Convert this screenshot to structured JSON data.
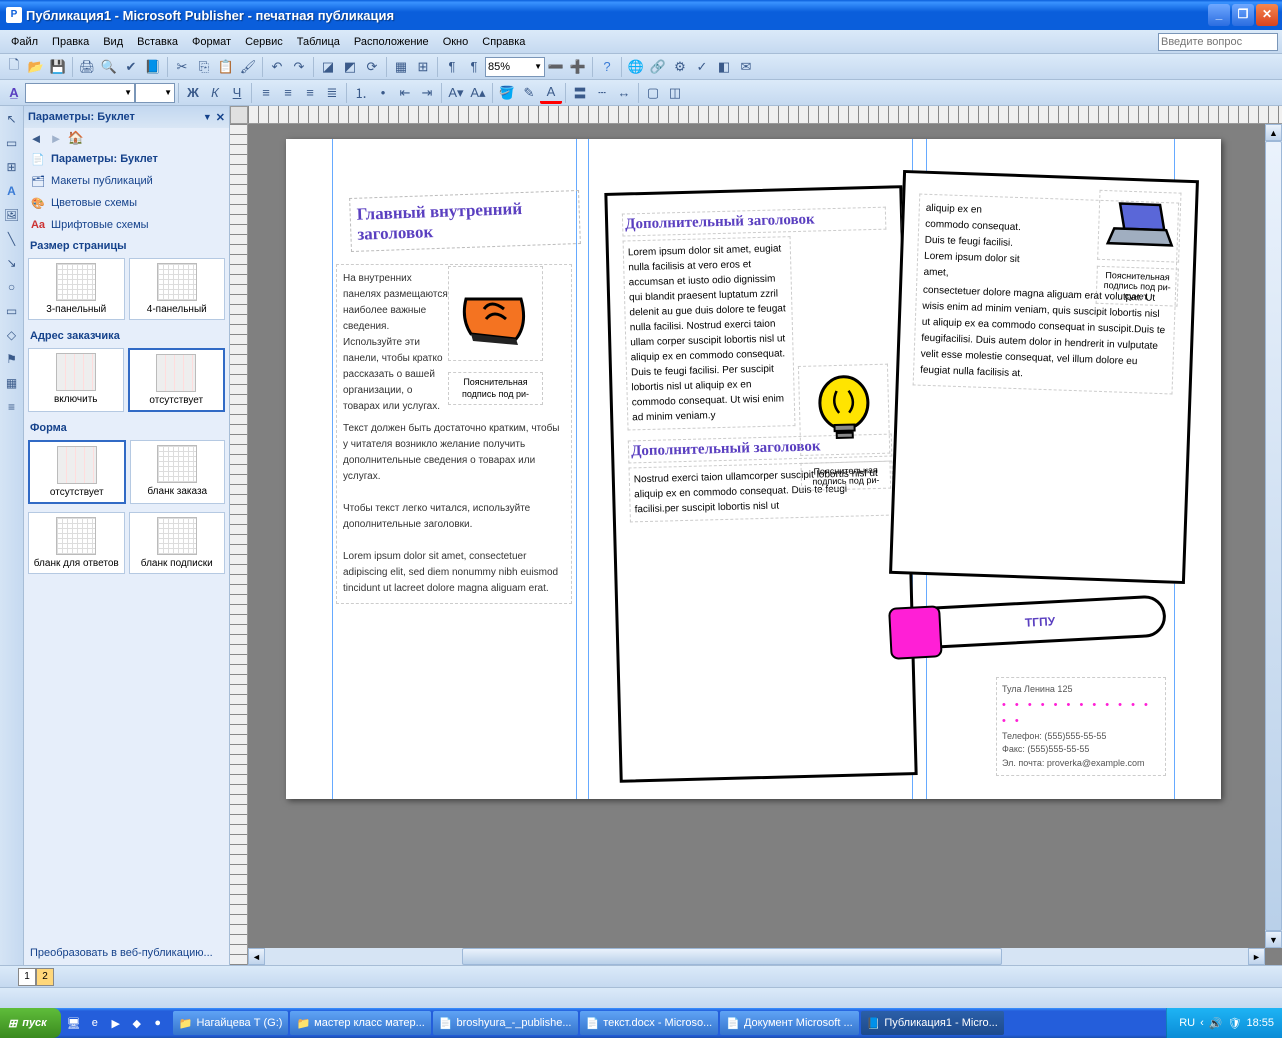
{
  "titlebar": {
    "title": "Публикация1 - Microsoft Publisher - печатная публикация"
  },
  "menu": {
    "file": "Файл",
    "edit": "Правка",
    "view": "Вид",
    "insert": "Вставка",
    "format": "Формат",
    "tools": "Сервис",
    "table": "Таблица",
    "arrange": "Расположение",
    "window": "Окно",
    "help": "Справка",
    "askbox": "Введите вопрос"
  },
  "tb": {
    "zoom": "85%",
    "font": "",
    "fontsize": ""
  },
  "taskpane": {
    "title": "Параметры: Буклет",
    "links": {
      "params": "Параметры: Буклет",
      "layouts": "Макеты публикаций",
      "colors": "Цветовые схемы",
      "fonts": "Шрифтовые схемы"
    },
    "pagesize": "Размер страницы",
    "thumbs_ps": {
      "a": "3-панельный",
      "b": "4-панельный"
    },
    "custaddr": "Адрес заказчика",
    "thumbs_ca": {
      "a": "включить",
      "b": "отсутствует"
    },
    "form": "Форма",
    "thumbs_f": {
      "a": "отсутствует",
      "b": "бланк заказа",
      "c": "бланк для ответов",
      "d": "бланк подписки"
    },
    "convert": "Преобразовать в веб-публикацию..."
  },
  "doc": {
    "p1": {
      "title": "Главный внутренний заголовок",
      "text1": "На внутренних панелях размещаются наиболее важные сведения. Используйте эти панели, чтобы кратко рассказать о вашей организации, о товарах или услугах.",
      "text2": "Текст должен быть достаточно кратким, чтобы у читателя возникло желание получить дополнительные сведения о товарах или услугах.",
      "text3": "Чтобы текст легко читался, используйте дополнительные заголовки.",
      "text4": "Lorem ipsum dolor sit amet, consectetuer adipiscing elit, sed diem nonummy nibh euismod tincidunt ut lacreet dolore magna aliguam erat.",
      "caption": "Пояснительная подпись под ри-"
    },
    "p2": {
      "h1": "Дополнительный заголовок",
      "t1": "Lorem ipsum dolor sit amet, eugiat nulla facilisis at vero eros et accumsan et iusto odio dignissim qui blandit praesent luptatum zzril delenit au gue duis dolore te feugat nulla facilisi. Nostrud exerci taion ullam corper suscipit lobortis nisl ut aliquip ex en commodo consequat. Duis te feugi facilisi. Per suscipit lobortis nisl ut aliquip ex en commodo consequat. Ut wisi enim ad minim veniam.y",
      "h2": "Дополнительный заголовок",
      "t2": "Nostrud exerci taion ullamcorper suscipit lobortis nisl ut aliquip ex en commodo consequat. Duis te feugi facilisi.per suscipit lobortis nisl ut",
      "caption": "Пояснительная подпись под ри-"
    },
    "p3": {
      "t": "aliquip ex en commodo consequat. Duis te feugi facilisi. Lorem ipsum dolor sit amet, consectetuer dolore magna aliguam erat volutpat. Ut wisis enim ad minim veniam, quis suscipit lobortis nisl ut aliquip ex ea commodo consequat in suscipit.Duis te feugifacilisi. Duis autem dolor in hendrerit in vulputate velit esse molestie consequat, vel illum dolore eu feugiat nulla facilisis at.",
      "caption": "Пояснительная подпись под ри-сунет."
    },
    "bubble": "ТГПУ",
    "addr": {
      "l1": "Тула Ленина 125",
      "l2": "Телефон: (555)555-55-55",
      "l3": "Факс: (555)555-55-55",
      "l4": "Эл. почта: proverka@example.com"
    }
  },
  "pagenav": {
    "p1": "1",
    "p2": "2"
  },
  "taskbar": {
    "start": "пуск",
    "items": {
      "a": "Нагайцева Т (G:)",
      "b": "мастер класс матер...",
      "c": "broshyura_-_publishe...",
      "d": "текст.docx - Microso...",
      "e": "Документ Microsoft ...",
      "f": "Публикация1 - Micro..."
    },
    "lang": "RU",
    "time": "18:55"
  }
}
